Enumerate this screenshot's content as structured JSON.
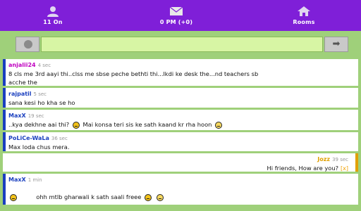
{
  "topbar": {
    "items": [
      {
        "label": "11 On",
        "icon": "user-icon"
      },
      {
        "label": "0 PM (+0)",
        "icon": "envelope-icon"
      },
      {
        "label": "Rooms",
        "icon": "home-icon"
      }
    ]
  },
  "input": {
    "placeholder": "",
    "value": "",
    "emoji_icon": "smiley-icon",
    "send_icon": "send-arrow-icon"
  },
  "messages": [
    {
      "user": "anjalii24",
      "time": "4 sec",
      "text": "8 cls me 3rd aayi thi..clss me sbse peche bethti thi...lkdi ke desk the...nd teachers sb",
      "text2": "acche the",
      "color": "#c000c0"
    },
    {
      "user": "rajpatil",
      "time": "5 sec",
      "text": "sana kesi ho kha se ho",
      "color": "#1a3fbf"
    },
    {
      "user": "MaxX",
      "time": "19 sec",
      "text": "..kya dekhne aai thi?",
      "text_b": "Mai konsa teri sis ke sath kaand kr rha hoon",
      "color": "#1a3fbf"
    },
    {
      "user": "PoLiCe-WaLa",
      "time": "36 sec",
      "text": "Max loda chus mera.",
      "color": "#1a3fbf"
    },
    {
      "user": "Jozz",
      "time": "39 sec",
      "text": "Hi friends, How are you?",
      "close": "[x]",
      "color": "#e0a000"
    },
    {
      "user": "MaxX",
      "time": "1 min",
      "text": "ohh mtlb gharwali k sath saali freee",
      "color": "#1a3fbf"
    }
  ],
  "colors": {
    "topbar": "#7f1fd8",
    "background": "#9fd07a",
    "input_bg": "#d7f5a4"
  }
}
